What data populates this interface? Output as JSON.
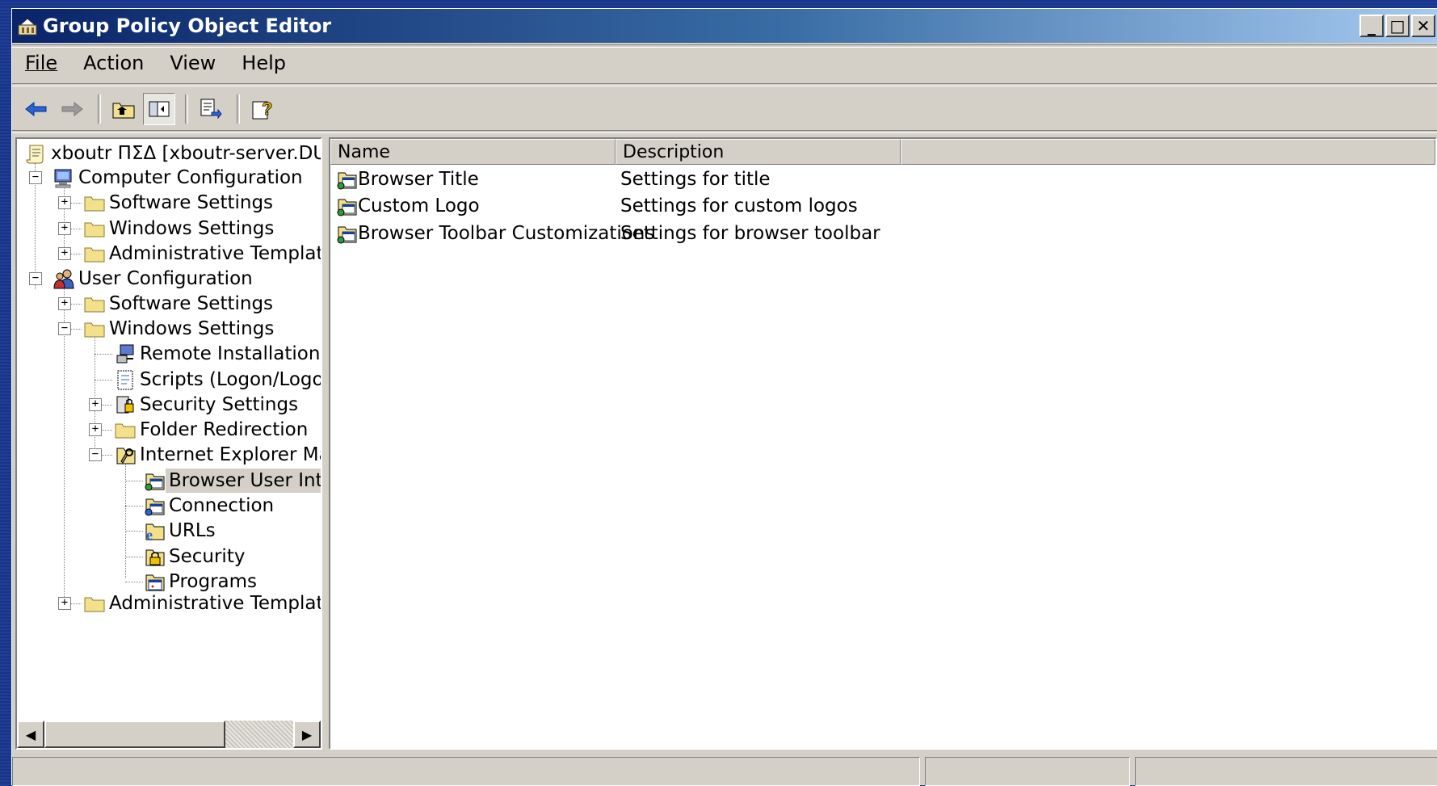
{
  "window": {
    "title": "Group Policy Object Editor"
  },
  "menu": [
    {
      "label": "File"
    },
    {
      "label": "Action"
    },
    {
      "label": "View"
    },
    {
      "label": "Help"
    }
  ],
  "toolbar": {
    "buttons": [
      "back-icon",
      "forward-icon",
      "up-folder-icon",
      "show-hide-tree-icon",
      "export-list-icon",
      "help-icon"
    ]
  },
  "tree": {
    "root": "xboutr ΠΣΔ [xboutr-server.DUTH.l",
    "computer_config": "Computer Configuration",
    "cc_software": "Software Settings",
    "cc_windows": "Windows Settings",
    "cc_admin": "Administrative Templates",
    "user_config": "User Configuration",
    "uc_software": "Software Settings",
    "uc_windows": "Windows Settings",
    "remote_install": "Remote Installation Ser",
    "scripts": "Scripts (Logon/Logoff)",
    "security_settings": "Security Settings",
    "folder_redirection": "Folder Redirection",
    "ie_maint": "Internet Explorer Maint",
    "browser_ui": "Browser User Inter",
    "connection": "Connection",
    "urls": "URLs",
    "security": "Security",
    "programs": "Programs",
    "uc_admin": "Administrative Templates"
  },
  "list": {
    "columns": [
      "Name",
      "Description"
    ],
    "rows": [
      {
        "name": "Browser Title",
        "description": "Settings for title"
      },
      {
        "name": "Custom Logo",
        "description": "Settings for custom logos"
      },
      {
        "name": "Browser Toolbar Customizations",
        "description": "Settings for browser toolbar"
      }
    ]
  },
  "colors": {
    "title_start": "#0a246a",
    "title_end": "#a6caf0",
    "face": "#d4d0c8",
    "folder": "#f3e08a"
  }
}
